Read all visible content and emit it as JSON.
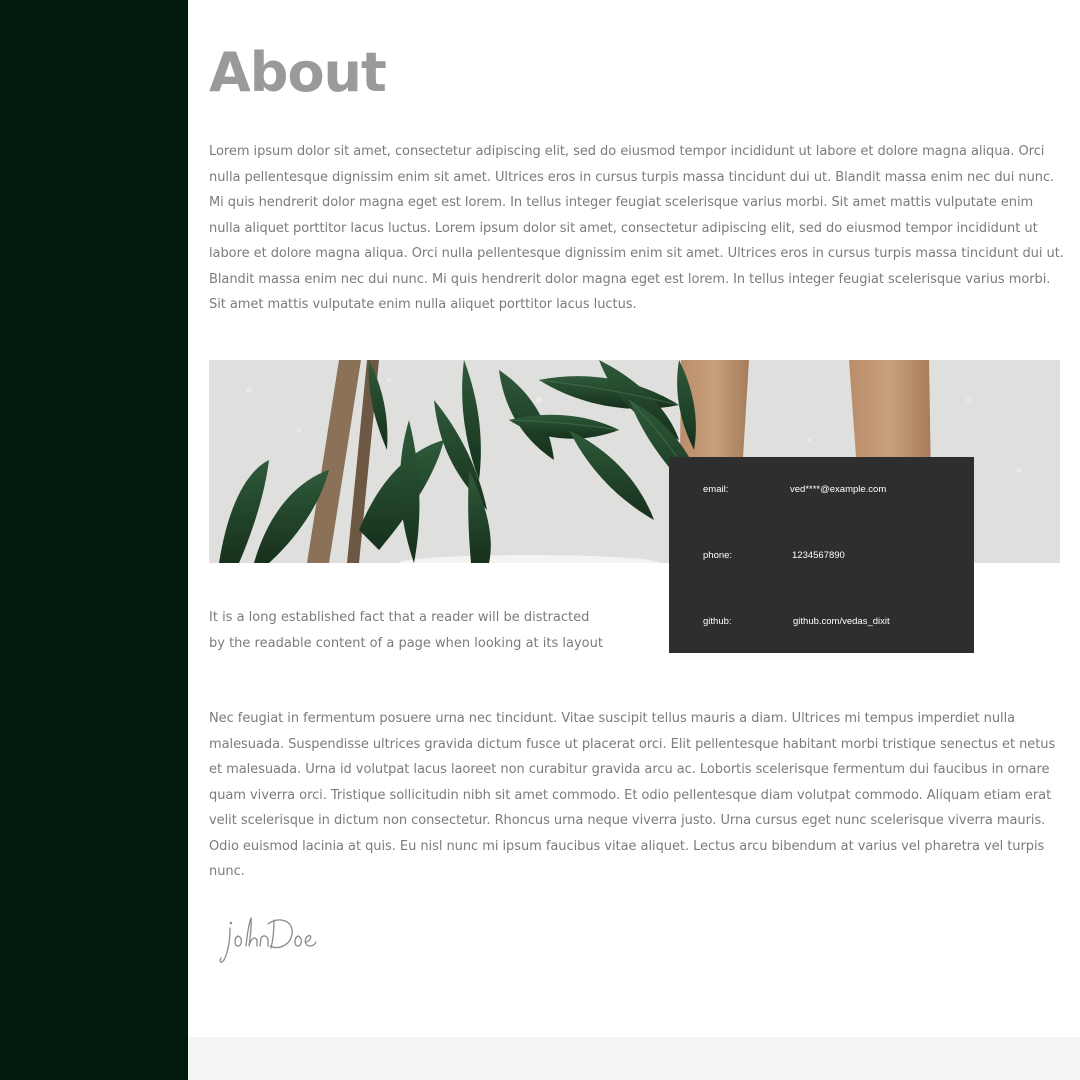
{
  "page": {
    "title": "About",
    "intro": "Lorem ipsum dolor sit amet, consectetur adipiscing elit, sed do eiusmod tempor incididunt ut labore et dolore magna aliqua. Orci nulla pellentesque dignissim enim sit amet. Ultrices eros in cursus turpis massa tincidunt dui ut. Blandit massa enim nec dui nunc. Mi quis hendrerit dolor magna eget est lorem. In tellus integer feugiat scelerisque varius morbi. Sit amet mattis vulputate enim nulla aliquet porttitor lacus luctus. Lorem ipsum dolor sit amet, consectetur adipiscing elit, sed do eiusmod tempor incididunt ut labore et dolore magna aliqua. Orci nulla pellentesque dignissim enim sit amet. Ultrices eros in cursus turpis massa tincidunt dui ut. Blandit massa enim nec dui nunc. Mi quis hendrerit dolor magna eget est lorem. In tellus integer feugiat scelerisque varius morbi. Sit amet mattis vulputate enim nulla aliquet porttitor lacus luctus.",
    "short_text": "It is a long established fact that a reader will be distracted by the readable content of a page when looking at its layout",
    "body": "Nec feugiat in fermentum posuere urna nec tincidunt. Vitae suscipit tellus mauris a diam. Ultrices mi tempus imperdiet nulla malesuada. Suspendisse ultrices gravida dictum fusce ut placerat orci. Elit pellentesque habitant morbi tristique senectus et netus et malesuada. Urna id volutpat lacus laoreet non curabitur gravida arcu ac. Lobortis scelerisque fermentum dui faucibus in ornare quam viverra orci. Tristique sollicitudin nibh sit amet commodo. Et odio pellentesque diam volutpat commodo. Aliquam etiam erat velit scelerisque in dictum non consectetur. Rhoncus urna neque viverra justo. Urna cursus eget nunc scelerisque viverra mauris. Odio euismod lacinia at quis. Eu nisl nunc mi ipsum faucibus vitae aliquet.  Lectus arcu bibendum at varius vel pharetra vel turpis nunc.",
    "signature": "johnDoe"
  },
  "contact": {
    "email_label": "email:",
    "email_value": "ved****@example.com",
    "phone_label": "phone:",
    "phone_value": "1234567890",
    "github_label": "github:",
    "github_value": "github.com/vedas_dixit"
  },
  "icons": {
    "hero_image": "plant-photo",
    "signature_image": "signature"
  },
  "colors": {
    "sidebar": "#021a0c",
    "title": "#9a9a9a",
    "text": "#7b7b7b",
    "card": "#2e2e2e"
  }
}
